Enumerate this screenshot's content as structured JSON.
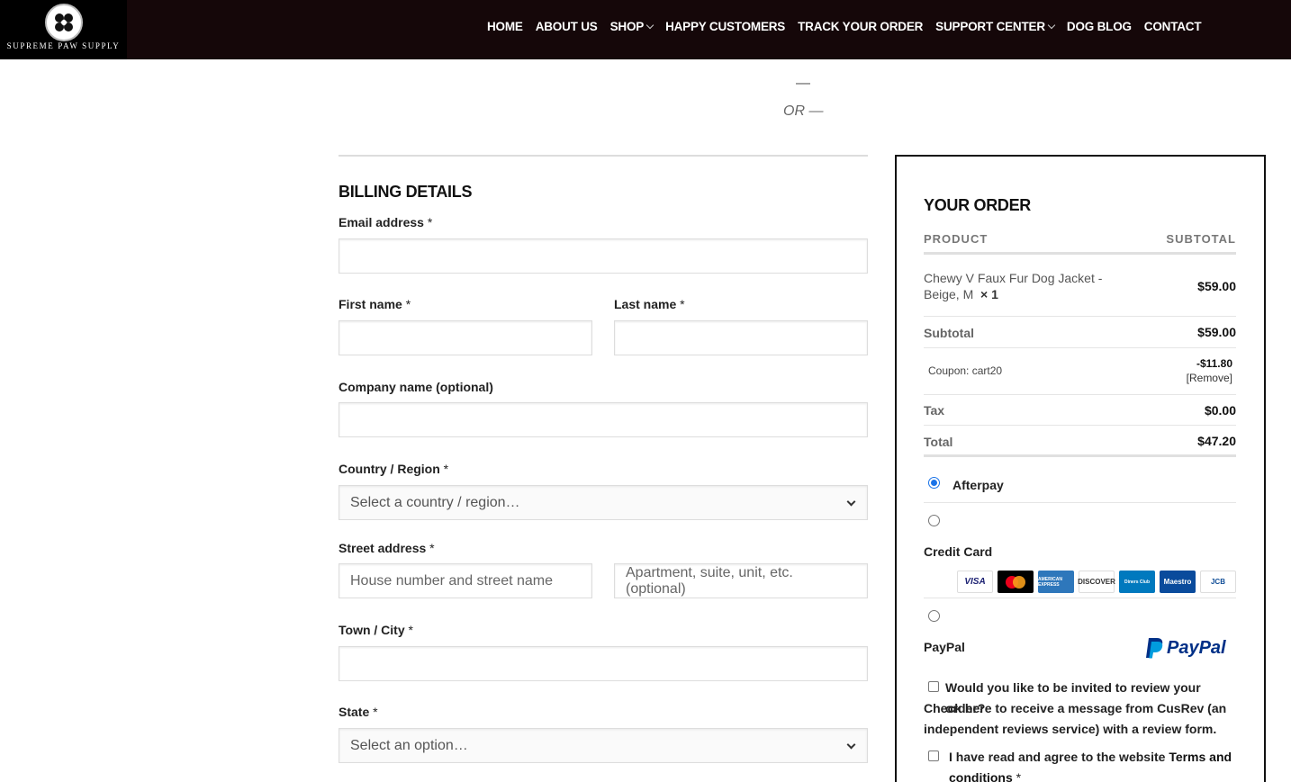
{
  "brand": {
    "name": "SUPREME PAW SUPPLY"
  },
  "nav": [
    {
      "label": "HOME"
    },
    {
      "label": "ABOUT US"
    },
    {
      "label": "SHOP",
      "dropdown": true
    },
    {
      "label": "HAPPY CUSTOMERS"
    },
    {
      "label": "TRACK YOUR ORDER"
    },
    {
      "label": "SUPPORT CENTER",
      "dropdown": true
    },
    {
      "label": "DOG BLOG"
    },
    {
      "label": "CONTACT"
    }
  ],
  "separator": {
    "dash": "—",
    "or": "OR —"
  },
  "billing": {
    "title": "BILLING DETAILS",
    "email_label": "Email address",
    "first_name_label": "First name",
    "last_name_label": "Last name",
    "company_label": "Company name (optional)",
    "country_label": "Country / Region",
    "country_value": "Select a country / region…",
    "street_label": "Street address",
    "street_placeholder": "House number and street name",
    "apartment_placeholder": "Apartment, suite, unit, etc. (optional)",
    "city_label": "Town / City",
    "state_label": "State",
    "state_value": "Select an option…",
    "required_mark": "*"
  },
  "order": {
    "title": "YOUR ORDER",
    "col_product": "PRODUCT",
    "col_subtotal": "SUBTOTAL",
    "item_name": "Chewy V Faux Fur Dog Jacket - Beige, M",
    "item_qty": "× 1",
    "item_price": "$59.00",
    "subtotal_label": "Subtotal",
    "subtotal_value": "$59.00",
    "coupon_label": "Coupon: cart20",
    "coupon_value": "-$11.80",
    "coupon_remove": "[Remove]",
    "tax_label": "Tax",
    "tax_value": "$0.00",
    "total_label": "Total",
    "total_value": "$47.20"
  },
  "payment": {
    "afterpay": "Afterpay",
    "credit_card": "Credit Card",
    "paypal": "PayPal",
    "paypal_logo": "PayPal",
    "selected": "afterpay",
    "cards": [
      {
        "name": "VISA",
        "bg": "#ffffff",
        "fg": "#1a1f71"
      },
      {
        "name": "",
        "bg": "#000000",
        "fg": "#ffffff"
      },
      {
        "name": "AMERICAN EXPRESS",
        "bg": "#2e77bb",
        "fg": "#ffffff"
      },
      {
        "name": "DISCOVER",
        "bg": "#ffffff",
        "fg": "#333333"
      },
      {
        "name": "Diners Club",
        "bg": "#0079be",
        "fg": "#ffffff"
      },
      {
        "name": "Maestro",
        "bg": "#0a4b9c",
        "fg": "#ffffff"
      },
      {
        "name": "JCB",
        "bg": "#ffffff",
        "fg": "#0e4c96"
      }
    ]
  },
  "review": {
    "line1": "Would you like to be invited to review your order?",
    "line2": "Check here to receive a message from CusRev (an independent reviews service) with a review form."
  },
  "terms": {
    "prefix": "I have read and agree to the website ",
    "link": "Terms and conditions",
    "required": "*"
  },
  "colors": {
    "header_bg": "#150709",
    "radio_accent": "#1a73e8",
    "paypal_dark": "#003087",
    "paypal_light": "#009cde"
  }
}
